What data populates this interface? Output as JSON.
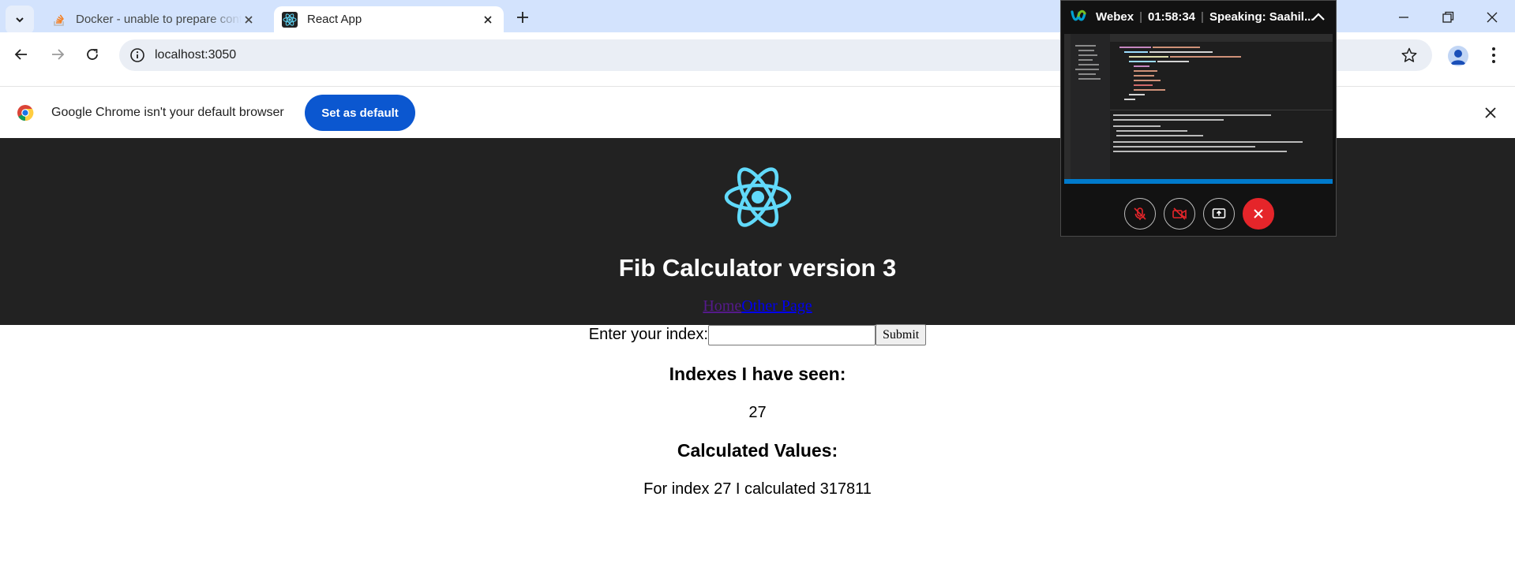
{
  "browser": {
    "tabs": [
      {
        "title": "Docker - unable to prepare context",
        "active": false
      },
      {
        "title": "React App",
        "active": true
      }
    ],
    "url": "localhost:3050"
  },
  "infobar": {
    "message": "Google Chrome isn't your default browser",
    "button": "Set as default"
  },
  "page": {
    "title": "Fib Calculator version 3",
    "nav": {
      "home": "Home",
      "other": "Other Page"
    },
    "form": {
      "label": "Enter your index:",
      "value": "",
      "submit": "Submit"
    },
    "seen_heading": "Indexes I have seen:",
    "seen_values": "27",
    "calc_heading": "Calculated Values:",
    "calc_values": [
      "For index 27 I calculated 317811"
    ]
  },
  "webex": {
    "app": "Webex",
    "timer": "01:58:34",
    "speaking": "Speaking: Saahil..."
  },
  "colors": {
    "accent": "#0b57d0",
    "header_bg": "#222222",
    "react": "#61dafb",
    "tabstrip": "#d3e3fd",
    "end_call": "#e5252a"
  }
}
